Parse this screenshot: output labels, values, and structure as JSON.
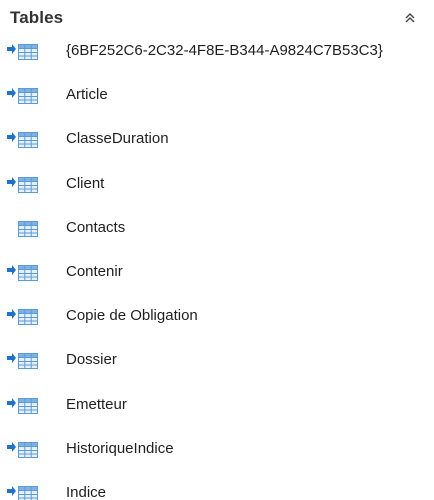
{
  "section": {
    "title": "Tables",
    "collapse_icon": "double-chevron-up-icon"
  },
  "tables": [
    {
      "label": "{6BF252C6-2C32-4F8E-B344-A9824C7B53C3}",
      "icon": "linked-table-icon",
      "linked": true
    },
    {
      "label": "Article",
      "icon": "linked-table-icon",
      "linked": true
    },
    {
      "label": "ClasseDuration",
      "icon": "linked-table-icon",
      "linked": true
    },
    {
      "label": "Client",
      "icon": "linked-table-icon",
      "linked": true
    },
    {
      "label": "Contacts",
      "icon": "table-icon",
      "linked": false
    },
    {
      "label": "Contenir",
      "icon": "linked-table-icon",
      "linked": true
    },
    {
      "label": "Copie de Obligation",
      "icon": "linked-table-icon",
      "linked": true
    },
    {
      "label": "Dossier",
      "icon": "linked-table-icon",
      "linked": true
    },
    {
      "label": "Emetteur",
      "icon": "linked-table-icon",
      "linked": true
    },
    {
      "label": "HistoriqueIndice",
      "icon": "linked-table-icon",
      "linked": true
    },
    {
      "label": "Indice",
      "icon": "linked-table-icon",
      "linked": true
    }
  ],
  "colors": {
    "arrow": "#1e73c8",
    "grid_line": "#5a9bd5",
    "grid_header": "#7fb2e2",
    "grid_fill": "#e8f1fb"
  }
}
